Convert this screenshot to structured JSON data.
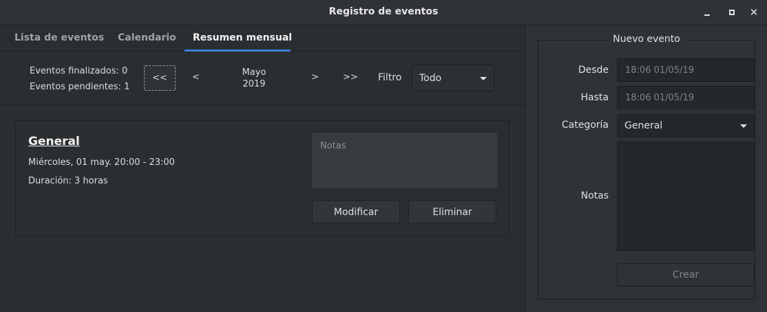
{
  "window": {
    "title": "Registro de eventos"
  },
  "tabs": [
    {
      "label": "Lista de eventos",
      "active": false
    },
    {
      "label": "Calendario",
      "active": false
    },
    {
      "label": "Resumen mensual",
      "active": true
    }
  ],
  "summary": {
    "finished": "Eventos finalizados: 0",
    "pending": "Eventos pendientes: 1",
    "nav": {
      "first": "<<",
      "prev": "<",
      "next": ">",
      "last": ">>"
    },
    "month": "Mayo",
    "year": "2019",
    "filter_label": "Filtro",
    "filter_value": "Todo"
  },
  "event": {
    "title": "General",
    "date": "Miércoles, 01 may. 20:00 - 23:00",
    "duration": "Duración:  3 horas",
    "notes_placeholder": "Notas",
    "modify_label": "Modificar",
    "delete_label": "Eliminar"
  },
  "new_event": {
    "frame_title": "Nuevo evento",
    "from_label": "Desde",
    "from_value": "18:06 01/05/19",
    "to_label": "Hasta",
    "to_value": "18:06 01/05/19",
    "category_label": "Categoría",
    "category_value": "General",
    "notes_label": "Notas",
    "create_label": "Crear"
  },
  "colors": {
    "accent": "#3b7dd8",
    "background": "#2b2e31"
  }
}
